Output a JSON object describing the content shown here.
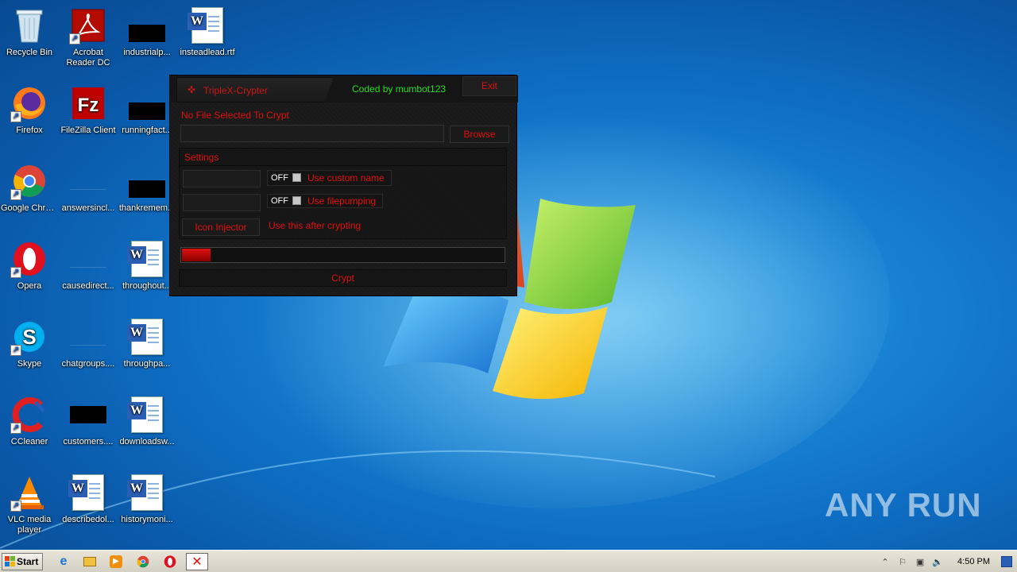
{
  "desktop": {
    "icons": [
      {
        "label": "Recycle Bin",
        "icon": "recycle-bin-icon"
      },
      {
        "label": "Acrobat Reader DC",
        "icon": "acrobat-icon"
      },
      {
        "label": "industrialp...",
        "icon": "black-file-icon"
      },
      {
        "label": "insteadlead.rtf",
        "icon": "word-doc-icon"
      },
      {
        "label": "Firefox",
        "icon": "firefox-icon"
      },
      {
        "label": "FileZilla Client",
        "icon": "filezilla-icon"
      },
      {
        "label": "runningfact...",
        "icon": "black-file-icon"
      },
      {
        "label": "Google Chrome",
        "icon": "chrome-icon"
      },
      {
        "label": "answersincl...",
        "icon": "blank-file-icon"
      },
      {
        "label": "thankremem...",
        "icon": "black-file-icon"
      },
      {
        "label": "Opera",
        "icon": "opera-icon"
      },
      {
        "label": "causedirect...",
        "icon": "blank-file-icon"
      },
      {
        "label": "throughout...",
        "icon": "word-doc-icon"
      },
      {
        "label": "Skype",
        "icon": "skype-icon"
      },
      {
        "label": "chatgroups....",
        "icon": "blank-file-icon"
      },
      {
        "label": "throughpa...",
        "icon": "word-doc-icon"
      },
      {
        "label": "CCleaner",
        "icon": "ccleaner-icon"
      },
      {
        "label": "customers....",
        "icon": "black-file-icon"
      },
      {
        "label": "downloadsw...",
        "icon": "word-doc-icon"
      },
      {
        "label": "VLC media player",
        "icon": "vlc-icon"
      },
      {
        "label": "describedol...",
        "icon": "word-doc-icon"
      },
      {
        "label": "historymoni...",
        "icon": "word-doc-icon"
      }
    ]
  },
  "crypter": {
    "title": "TripleX-Crypter",
    "coded_by": "Coded by mumbot123",
    "exit_label": "Exit",
    "status": "No File Selected To Crypt",
    "path_value": "",
    "browse_label": "Browse",
    "settings_label": "Settings",
    "custom_name_value": "",
    "filepump_value": "",
    "toggle_off": "OFF",
    "custom_name_label": "Use custom name",
    "filepumping_label": "Use filepumping",
    "icon_injector_label": "Icon Injector",
    "hint": "Use this after crypting",
    "progress_fraction": 0.09,
    "crypt_label": "Crypt",
    "accent_color": "#e01010",
    "credit_color": "#22dd22"
  },
  "watermark": "ANY RUN",
  "taskbar": {
    "start_label": "Start",
    "items": [
      "ie-icon",
      "explorer-icon",
      "media-player-icon",
      "chrome-icon",
      "opera-icon",
      "crypter-app-icon"
    ],
    "clock": "4:50 PM"
  }
}
